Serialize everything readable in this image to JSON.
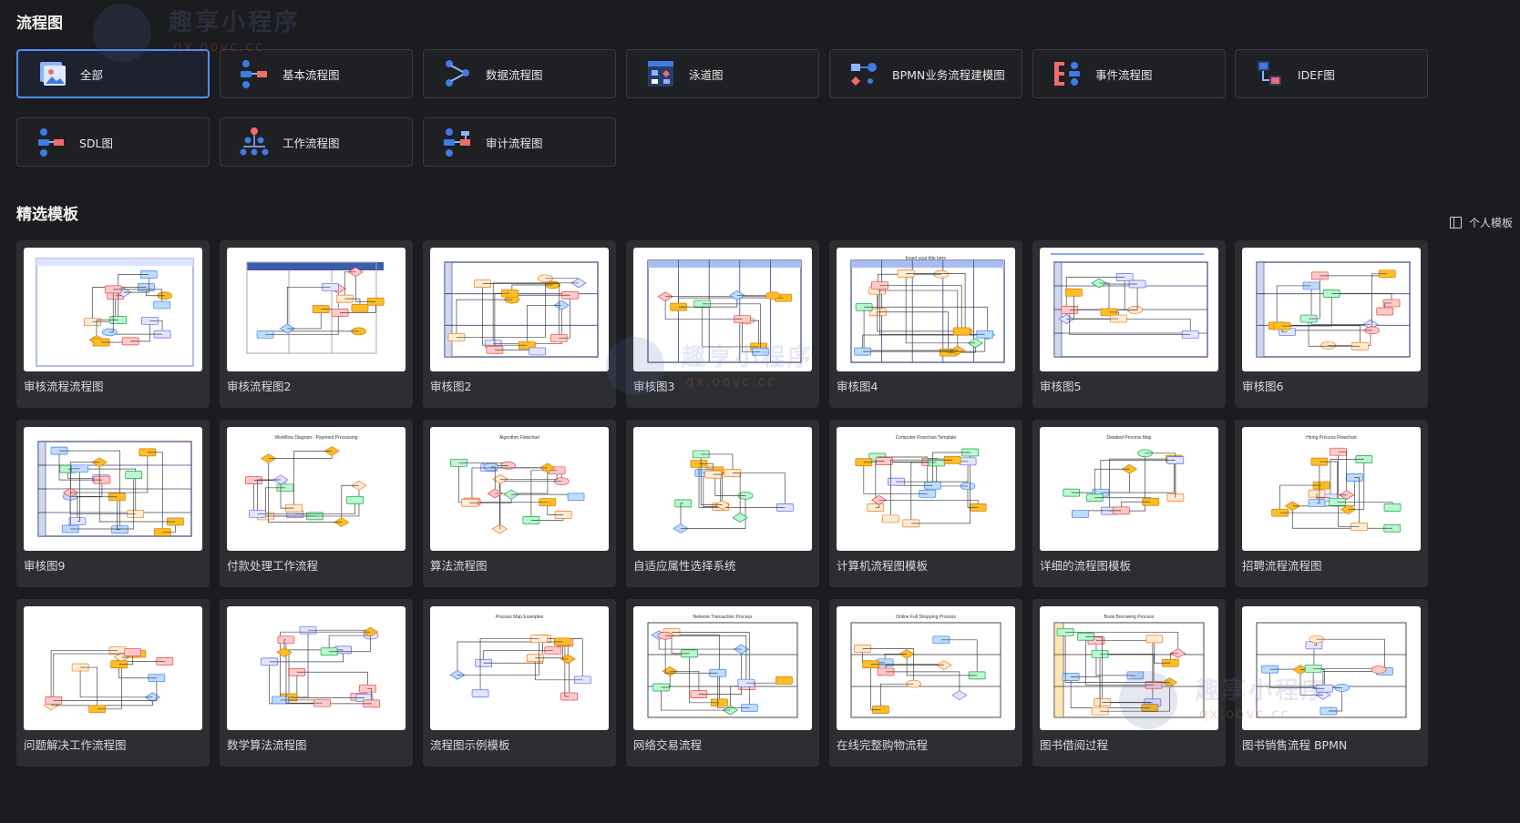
{
  "sections": {
    "flowchart_title": "流程图",
    "templates_title": "精选模板",
    "personal_templates": "个人模板"
  },
  "categories": [
    {
      "label": "全部",
      "icon": "all-icon"
    },
    {
      "label": "基本流程图",
      "icon": "basic-flow-icon"
    },
    {
      "label": "数据流程图",
      "icon": "data-flow-icon"
    },
    {
      "label": "泳道图",
      "icon": "swimlane-icon"
    },
    {
      "label": "BPMN业务流程建模图",
      "icon": "bpmn-icon"
    },
    {
      "label": "事件流程图",
      "icon": "event-flow-icon"
    },
    {
      "label": "IDEF图",
      "icon": "idef-icon"
    },
    {
      "label": "SDL图",
      "icon": "sdl-icon"
    },
    {
      "label": "工作流程图",
      "icon": "workflow-icon"
    },
    {
      "label": "审计流程图",
      "icon": "audit-flow-icon"
    }
  ],
  "templates": [
    {
      "label": "审核流程流程图"
    },
    {
      "label": "审核流程图2"
    },
    {
      "label": "审核图2"
    },
    {
      "label": "审核图3"
    },
    {
      "label": "审核图4"
    },
    {
      "label": "审核图5"
    },
    {
      "label": "审核图6"
    },
    {
      "label": "审核图9"
    },
    {
      "label": "付款处理工作流程"
    },
    {
      "label": "算法流程图"
    },
    {
      "label": "自适应属性选择系统"
    },
    {
      "label": "计算机流程图模板"
    },
    {
      "label": "详细的流程图模板"
    },
    {
      "label": "招聘流程流程图"
    },
    {
      "label": "问题解决工作流程图"
    },
    {
      "label": "数学算法流程图"
    },
    {
      "label": "流程图示例模板"
    },
    {
      "label": "网络交易流程"
    },
    {
      "label": "在线完整购物流程"
    },
    {
      "label": "图书借阅过程"
    },
    {
      "label": "图书销售流程 BPMN"
    }
  ],
  "thumb_texts": {
    "t4": "Insert your title here",
    "t8": "Workflow Diagram - Payment Processing",
    "t9": "Algorithm Flowchart",
    "t11": "Computer Flowchart Template",
    "t12": "Detailed Process Map",
    "t13": "Hiring Process Flowchart",
    "t16": "Process Map Examples",
    "t17": "Network Transaction Process",
    "t18": "Online Full Shopping Process",
    "t19": "Book Borrowing Process"
  },
  "watermark": {
    "brand": "趣享小程序",
    "domain": "qx.oovc.cc"
  },
  "colors": {
    "accent": "#4f8ef7",
    "bg": "#1b1c1f",
    "card": "#2d2e32",
    "red": "#f26b6b",
    "blue": "#3f7be8"
  }
}
